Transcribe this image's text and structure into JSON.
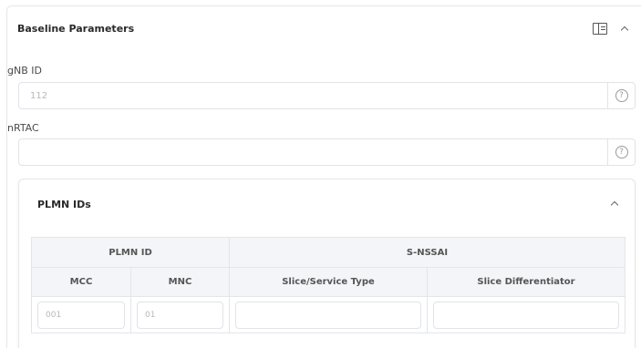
{
  "section": {
    "title": "Baseline Parameters"
  },
  "fields": {
    "gnb_id": {
      "label": "gNB ID",
      "placeholder": "112",
      "value": ""
    },
    "nrtac": {
      "label": "nRTAC",
      "placeholder": "",
      "value": ""
    }
  },
  "help_symbol": "?",
  "plmn": {
    "title": "PLMN IDs",
    "group_headers": {
      "plmn_id": "PLMN ID",
      "s_nssai": "S-NSSAI"
    },
    "columns": {
      "mcc": "MCC",
      "mnc": "MNC",
      "sst": "Slice/Service Type",
      "sd": "Slice Differentiator"
    },
    "row": {
      "mcc_placeholder": "001",
      "mnc_placeholder": "01",
      "sst_placeholder": "",
      "sd_placeholder": ""
    }
  },
  "icons": [
    "panel-toggle-icon",
    "chevron-up-icon",
    "help-circle-icon"
  ]
}
